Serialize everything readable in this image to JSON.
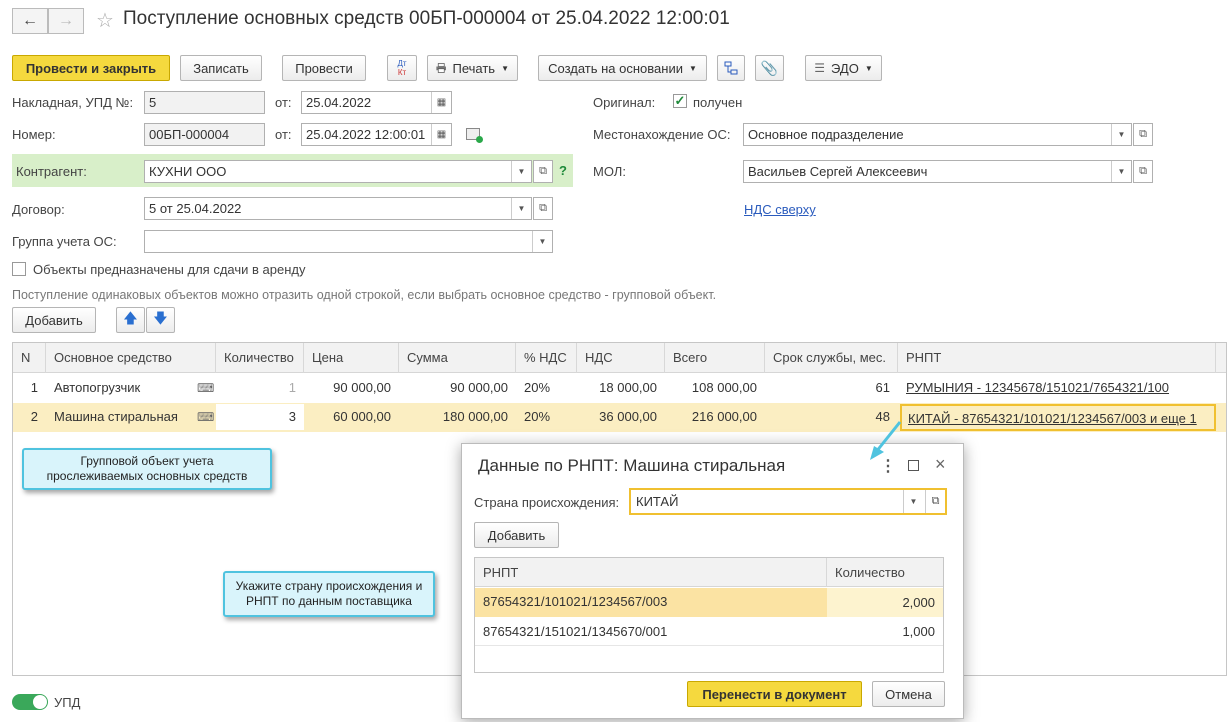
{
  "window": {
    "title": "Поступление основных средств 00БП-000004 от 25.04.2022 12:00:01",
    "back_icon": "arrow-left-icon",
    "forward_icon": "arrow-right-icon",
    "star_icon": "star-icon"
  },
  "toolbar": {
    "post_close": "Провести и закрыть",
    "save": "Записать",
    "post": "Провести",
    "dt_kt_top": "Дт",
    "dt_kt_bottom": "Кт",
    "print": "Печать",
    "create_based": "Создать на основании",
    "edo": "ЭДО"
  },
  "form": {
    "invoice_label": "Накладная, УПД №:",
    "invoice_value": "5",
    "from_label": "от:",
    "invoice_date": "25.04.2022",
    "number_label": "Номер:",
    "number_value": "00БП-000004",
    "number_from_label": "от:",
    "number_date": "25.04.2022 12:00:01",
    "counterparty_label": "Контрагент:",
    "counterparty_value": "КУХНИ ООО",
    "help": "?",
    "contract_label": "Договор:",
    "contract_value": "5 от 25.04.2022",
    "group_label": "Группа учета ОС:",
    "group_value": "",
    "original_label": "Оригинал:",
    "original_received": "получен",
    "location_label": "Местонахождение ОС:",
    "location_value": "Основное подразделение",
    "mol_label": "МОЛ:",
    "mol_value": "Васильев Сергей Алексеевич",
    "vat_link": "НДС сверху",
    "rent_label": "Объекты предназначены для сдачи в аренду",
    "hint": "Поступление одинаковых объектов можно отразить одной строкой, если выбрать основное средство - групповой объект.",
    "add_button": "Добавить"
  },
  "table": {
    "columns": [
      "N",
      "Основное средство",
      "Количество",
      "Цена",
      "Сумма",
      "% НДС",
      "НДС",
      "Всего",
      "Срок службы, мес.",
      "РНПТ"
    ],
    "rows": [
      {
        "n": "1",
        "asset": "Автопогрузчик",
        "qty": "1",
        "price": "90 000,00",
        "sum": "90 000,00",
        "vat_rate": "20%",
        "vat": "18 000,00",
        "total": "108 000,00",
        "life": "61",
        "rnpt": "РУМЫНИЯ - 12345678/151021/7654321/100"
      },
      {
        "n": "2",
        "asset": "Машина стиральная",
        "qty": "3",
        "price": "60 000,00",
        "sum": "180 000,00",
        "vat_rate": "20%",
        "vat": "36 000,00",
        "total": "216 000,00",
        "life": "48",
        "rnpt": "КИТАЙ - 87654321/101021/1234567/003 и еще 1"
      }
    ]
  },
  "callouts": {
    "group_object": "Групповой объект учета прослеживаемых основных средств",
    "specify_country": "Укажите страну происхождения и РНПТ по данным поставщика"
  },
  "dialog": {
    "title": "Данные по РНПТ: Машина стиральная",
    "country_label": "Страна происхождения:",
    "country_value": "КИТАЙ",
    "add_button": "Добавить",
    "columns": [
      "РНПТ",
      "Количество"
    ],
    "rows": [
      {
        "rnpt": "87654321/101021/1234567/003",
        "qty": "2,000"
      },
      {
        "rnpt": "87654321/151021/1345670/001",
        "qty": "1,000"
      }
    ],
    "transfer_button": "Перенести в документ",
    "cancel_button": "Отмена"
  },
  "footer": {
    "upd_toggle": "УПД"
  },
  "colors": {
    "accent_yellow": "#f5d93e",
    "selected_row": "#fbeec2",
    "counterparty_bg": "#d8efc9",
    "callout_bg": "#d9f4fb",
    "link": "#2a5bbd"
  }
}
